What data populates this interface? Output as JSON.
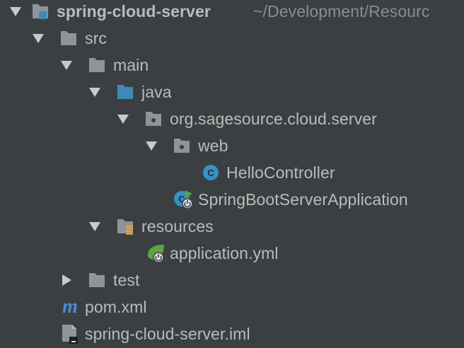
{
  "colors": {
    "background": "#3c3f41",
    "text": "#bbbbbb",
    "muted_text": "#8c8c8c",
    "folder": "#8e9499",
    "source_folder": "#3d8ab8",
    "class_badge": "#3592c4",
    "spring_green": "#5fa53c",
    "maven_blue": "#4a8cd6"
  },
  "project_tree": {
    "root": {
      "name": "spring-cloud-server",
      "path": "~/Development/Resourc",
      "icon": "module-folder-icon",
      "expanded": true
    },
    "src": {
      "name": "src",
      "icon": "folder-icon",
      "expanded": true
    },
    "main": {
      "name": "main",
      "icon": "folder-icon",
      "expanded": true
    },
    "java": {
      "name": "java",
      "icon": "source-root-folder-icon",
      "expanded": true
    },
    "package": {
      "name": "org.sagesource.cloud.server",
      "icon": "package-icon",
      "expanded": true
    },
    "web": {
      "name": "web",
      "icon": "package-icon",
      "expanded": true
    },
    "hello_controller": {
      "name": "HelloController",
      "icon": "java-class-icon"
    },
    "app_class": {
      "name": "SpringBootServerApplication",
      "icon": "spring-boot-class-icon"
    },
    "resources": {
      "name": "resources",
      "icon": "resources-folder-icon",
      "expanded": true
    },
    "application_yml": {
      "name": "application.yml",
      "icon": "spring-config-icon"
    },
    "test": {
      "name": "test",
      "icon": "folder-icon",
      "expanded": false
    },
    "pom": {
      "name": "pom.xml",
      "icon": "maven-icon"
    },
    "iml": {
      "name": "spring-cloud-server.iml",
      "icon": "iml-file-icon"
    }
  }
}
